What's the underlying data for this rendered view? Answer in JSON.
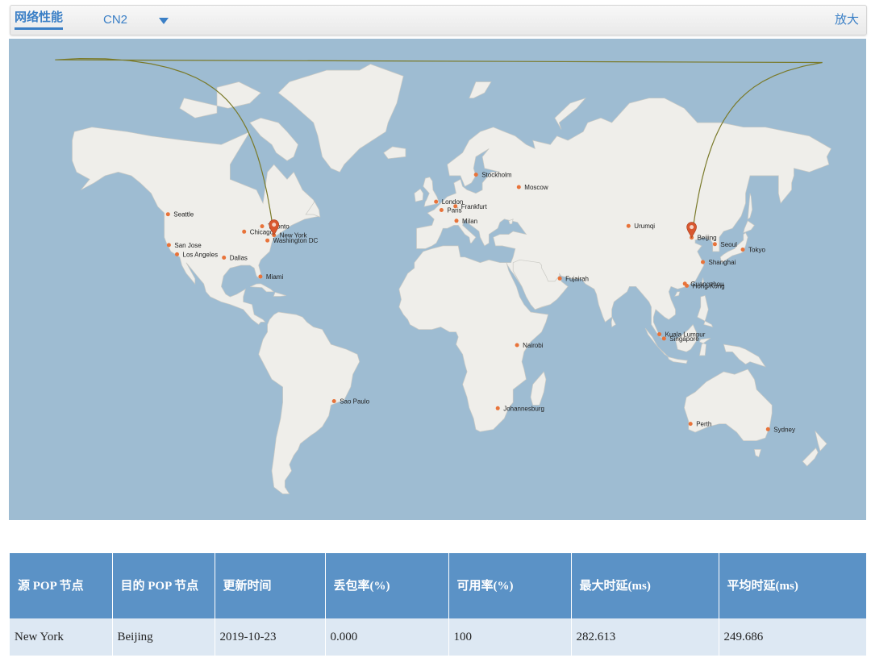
{
  "toolbar": {
    "tab_label": "网络性能",
    "line_select": "CN2",
    "zoom_label": "放大"
  },
  "map": {
    "ocean_color": "#9ebcd2",
    "land_color": "#efeeea",
    "route_color": "#7a7a2a",
    "city_dot_color": "#e8733a",
    "source_city": "New York",
    "destination_city": "Beijing",
    "cities": [
      {
        "name": "Seattle",
        "lat": 47.6,
        "lon": -122.3
      },
      {
        "name": "San Jose",
        "lat": 37.3,
        "lon": -121.9
      },
      {
        "name": "Los Angeles",
        "lat": 34.0,
        "lon": -118.2
      },
      {
        "name": "Dallas",
        "lat": 32.8,
        "lon": -96.8
      },
      {
        "name": "Chicago",
        "lat": 41.9,
        "lon": -87.6
      },
      {
        "name": "Toronto",
        "lat": 43.7,
        "lon": -79.4
      },
      {
        "name": "New York",
        "lat": 40.7,
        "lon": -74.0
      },
      {
        "name": "Washington DC",
        "lat": 38.9,
        "lon": -77.0
      },
      {
        "name": "Miami",
        "lat": 25.8,
        "lon": -80.2
      },
      {
        "name": "Sao Paulo",
        "lat": -23.5,
        "lon": -46.6
      },
      {
        "name": "London",
        "lat": 51.5,
        "lon": -0.1
      },
      {
        "name": "Paris",
        "lat": 48.9,
        "lon": 2.35
      },
      {
        "name": "Frankfurt",
        "lat": 50.1,
        "lon": 8.7
      },
      {
        "name": "Milan",
        "lat": 45.5,
        "lon": 9.2
      },
      {
        "name": "Stockholm",
        "lat": 59.3,
        "lon": 18.1
      },
      {
        "name": "Moscow",
        "lat": 55.8,
        "lon": 37.6
      },
      {
        "name": "Fujairah",
        "lat": 25.1,
        "lon": 56.3
      },
      {
        "name": "Nairobi",
        "lat": -1.3,
        "lon": 36.8
      },
      {
        "name": "Johannesburg",
        "lat": -26.2,
        "lon": 28.0
      },
      {
        "name": "Urumqi",
        "lat": 43.8,
        "lon": 87.6
      },
      {
        "name": "Beijing",
        "lat": 39.9,
        "lon": 116.4
      },
      {
        "name": "Seoul",
        "lat": 37.6,
        "lon": 127.0
      },
      {
        "name": "Tokyo",
        "lat": 35.7,
        "lon": 139.7
      },
      {
        "name": "Shanghai",
        "lat": 31.2,
        "lon": 121.5
      },
      {
        "name": "Guangzhou",
        "lat": 23.1,
        "lon": 113.3
      },
      {
        "name": "Hong Kong",
        "lat": 22.3,
        "lon": 114.2
      },
      {
        "name": "Kuala Lumpur",
        "lat": 3.1,
        "lon": 101.7
      },
      {
        "name": "Singapore",
        "lat": 1.35,
        "lon": 103.8
      },
      {
        "name": "Perth",
        "lat": -31.95,
        "lon": 115.9
      },
      {
        "name": "Sydney",
        "lat": -33.9,
        "lon": 151.2
      }
    ]
  },
  "table": {
    "headers": [
      "源 POP 节点",
      "目的 POP 节点",
      "更新时间",
      "丢包率(%)",
      "可用率(%)",
      "最大时延(ms)",
      "平均时延(ms)"
    ],
    "row": [
      "New York",
      "Beijing",
      "2019-10-23",
      "0.000",
      "100",
      "282.613",
      "249.686"
    ]
  }
}
